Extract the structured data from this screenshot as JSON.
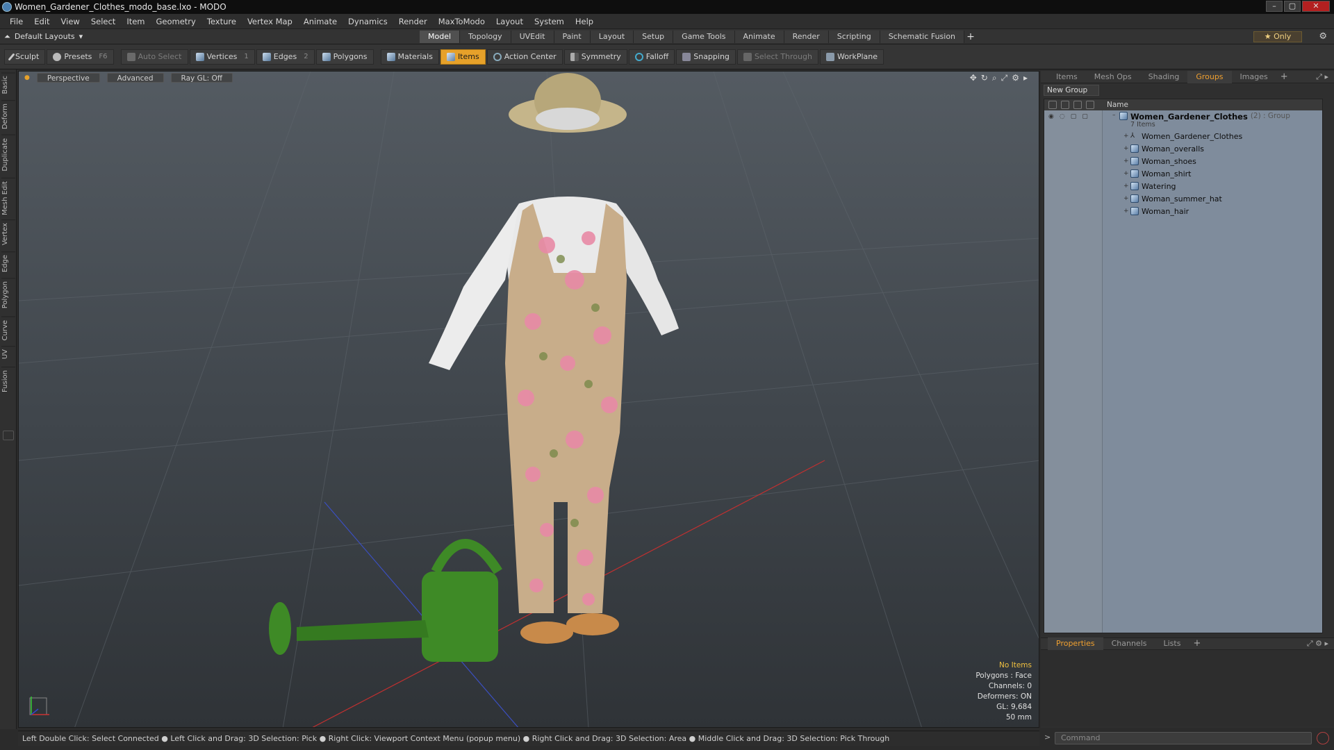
{
  "window": {
    "title": "Women_Gardener_Clothes_modo_base.lxo - MODO",
    "controls": [
      "–",
      "▢",
      "✕"
    ]
  },
  "menubar": [
    "File",
    "Edit",
    "View",
    "Select",
    "Item",
    "Geometry",
    "Texture",
    "Vertex Map",
    "Animate",
    "Dynamics",
    "Render",
    "MaxToModo",
    "Layout",
    "System",
    "Help"
  ],
  "layoutbar": {
    "layouts_label": "Default Layouts",
    "tabs": [
      "Model",
      "Topology",
      "UVEdit",
      "Paint",
      "Layout",
      "Setup",
      "Game Tools",
      "Animate",
      "Render",
      "Scripting",
      "Schematic Fusion"
    ],
    "active_tab": "Model",
    "only_label": "★  Only"
  },
  "toolbar": {
    "sculpt": "Sculpt",
    "presets": "Presets",
    "presets_key": "F6",
    "auto_select": "Auto Select",
    "vertices": "Vertices",
    "vertices_count": "1",
    "edges": "Edges",
    "edges_count": "2",
    "polygons": "Polygons",
    "materials": "Materials",
    "items": "Items",
    "action_center": "Action Center",
    "symmetry": "Symmetry",
    "falloff": "Falloff",
    "snapping": "Snapping",
    "select_through": "Select Through",
    "workplane": "WorkPlane"
  },
  "left_tabs": [
    "Basic",
    "Deform",
    "Duplicate",
    "Mesh Edit",
    "Vertex",
    "Edge",
    "Polygon",
    "Curve",
    "UV",
    "Fusion"
  ],
  "viewport": {
    "view": "Perspective",
    "shading": "Advanced",
    "raygl": "Ray GL: Off",
    "info": {
      "no_items": "No Items",
      "polygons": "Polygons : Face",
      "channels": "Channels: 0",
      "deformers": "Deformers: ON",
      "gl": "GL: 9,684",
      "focal": "50 mm"
    }
  },
  "right_panel": {
    "tabs": [
      "Items",
      "Mesh Ops",
      "Shading",
      "Groups",
      "Images"
    ],
    "active_tab": "Groups",
    "new_group": "New Group",
    "column_name": "Name",
    "group": {
      "name": "Women_Gardener_Clothes",
      "meta": "(2) : Group",
      "sub": "7 Items"
    },
    "items": [
      {
        "name": "Women_Gardener_Clothes",
        "icon": "locator-icon"
      },
      {
        "name": "Woman_overalls",
        "icon": "mesh-icon"
      },
      {
        "name": "Woman_shoes",
        "icon": "mesh-icon"
      },
      {
        "name": "Woman_shirt",
        "icon": "mesh-icon"
      },
      {
        "name": "Watering",
        "icon": "mesh-icon"
      },
      {
        "name": "Woman_summer_hat",
        "icon": "mesh-icon"
      },
      {
        "name": "Woman_hair",
        "icon": "mesh-icon"
      }
    ],
    "props_tabs": [
      "Properties",
      "Channels",
      "Lists"
    ],
    "props_active": "Properties"
  },
  "statusbar": "Left Double Click: Select Connected ● Left Click and Drag: 3D Selection: Pick ● Right Click: Viewport Context Menu (popup menu) ● Right Click and Drag: 3D Selection: Area ● Middle Click and Drag: 3D Selection: Pick Through",
  "command": {
    "placeholder": "Command"
  },
  "colors": {
    "accent": "#e6a12a",
    "tree_bg": "#7f8c9c"
  }
}
